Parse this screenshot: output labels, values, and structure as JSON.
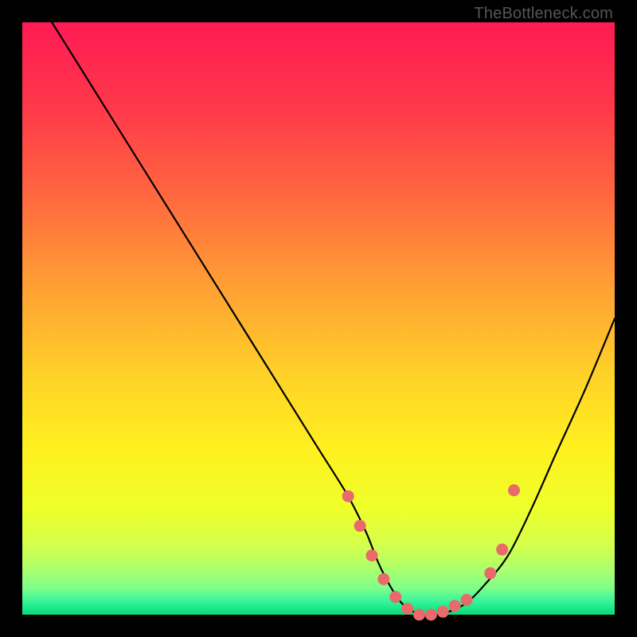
{
  "watermark": "TheBottleneck.com",
  "chart_data": {
    "type": "line",
    "title": "",
    "xlabel": "",
    "ylabel": "",
    "xlim": [
      0,
      100
    ],
    "ylim": [
      0,
      100
    ],
    "grid": false,
    "series": [
      {
        "name": "bottleneck-curve",
        "x": [
          5,
          10,
          15,
          20,
          25,
          30,
          35,
          40,
          45,
          50,
          55,
          58,
          60,
          62,
          64,
          66,
          68,
          70,
          72,
          75,
          78,
          82,
          86,
          90,
          95,
          100
        ],
        "y": [
          100,
          92,
          84,
          76,
          68,
          60,
          52,
          44,
          36,
          28,
          20,
          14,
          9,
          5,
          2,
          0.5,
          0,
          0,
          0.5,
          2,
          5,
          10,
          18,
          27,
          38,
          50
        ]
      }
    ],
    "markers": {
      "name": "highlight-points",
      "color": "#e86a6a",
      "x": [
        55,
        57,
        59,
        61,
        63,
        65,
        67,
        69,
        71,
        73,
        75,
        79,
        81,
        83
      ],
      "y": [
        20,
        15,
        10,
        6,
        3,
        1,
        0,
        0,
        0.5,
        1.5,
        2.5,
        7,
        11,
        21
      ]
    },
    "background_gradient": {
      "stops": [
        {
          "pos": 0.0,
          "color": "#ff1a54"
        },
        {
          "pos": 0.15,
          "color": "#ff3a4a"
        },
        {
          "pos": 0.3,
          "color": "#ff6a3f"
        },
        {
          "pos": 0.45,
          "color": "#ffa133"
        },
        {
          "pos": 0.6,
          "color": "#ffd328"
        },
        {
          "pos": 0.72,
          "color": "#fff01f"
        },
        {
          "pos": 0.82,
          "color": "#eeff2a"
        },
        {
          "pos": 0.88,
          "color": "#d6ff4a"
        },
        {
          "pos": 0.92,
          "color": "#b0ff6a"
        },
        {
          "pos": 0.955,
          "color": "#7fff8a"
        },
        {
          "pos": 0.975,
          "color": "#40f59a"
        },
        {
          "pos": 0.99,
          "color": "#16e888"
        },
        {
          "pos": 1.0,
          "color": "#0fd878"
        }
      ]
    }
  }
}
